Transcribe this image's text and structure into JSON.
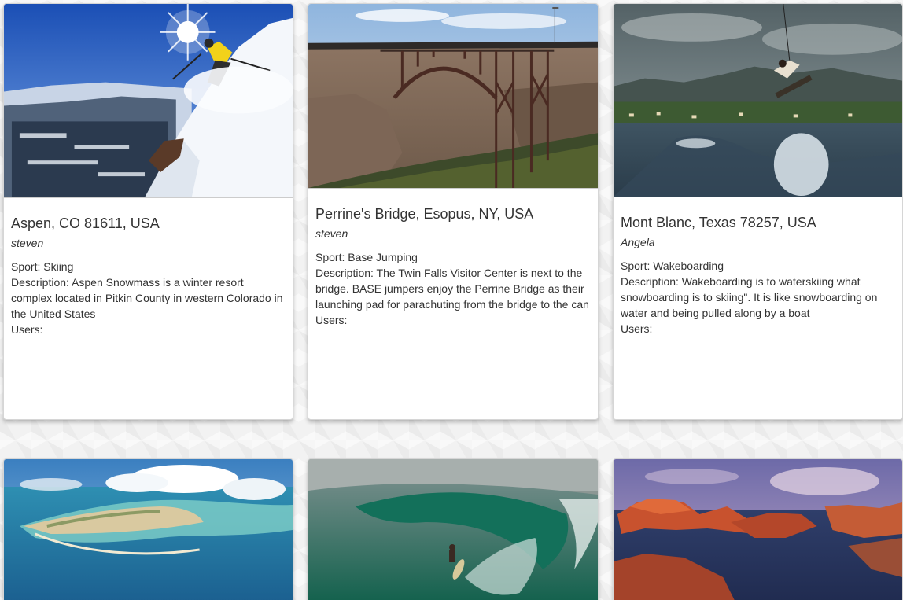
{
  "cards": [
    {
      "title": "Aspen, CO 81611, USA",
      "author": "steven",
      "sport_label": "Sport: Skiing",
      "description_label": "Description: Aspen Snowmass is a winter resort complex located in Pitkin County in western Colorado in the United States",
      "users_label": "Users:"
    },
    {
      "title": "Perrine's Bridge, Esopus, NY, USA",
      "author": "steven",
      "sport_label": "Sport: Base Jumping",
      "description_label": "Description: The Twin Falls Visitor Center is next to the bridge. BASE jumpers enjoy the Perrine Bridge as their launching pad for parachuting from the bridge to the can",
      "users_label": "Users:"
    },
    {
      "title": "Mont Blanc, Texas 78257, USA",
      "author": "Angela",
      "sport_label": "Sport: Wakeboarding",
      "description_label": "Description: Wakeboarding is to waterskiing what snowboarding is to skiing\". It is like snowboarding on water and being pulled along by a boat",
      "users_label": "Users:"
    },
    {
      "title": "",
      "author": ""
    },
    {
      "title": "",
      "author": ""
    },
    {
      "title": "",
      "author": ""
    }
  ]
}
